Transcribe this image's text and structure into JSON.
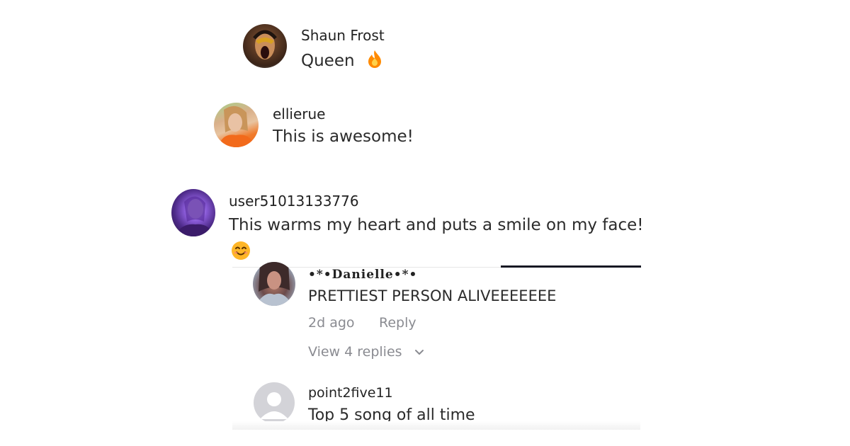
{
  "comments": [
    {
      "username": "Shaun Frost",
      "text": "Queen",
      "emoji": "fire-emoji"
    },
    {
      "username": "ellierue",
      "text": "This is awesome!"
    },
    {
      "username": "user51013133776",
      "text": "This warms my heart and puts a smile on my face!",
      "emoji": "smiling-face-emoji"
    }
  ],
  "replies": [
    {
      "username": "•*•Danielle•*•",
      "text": "PRETTIEST PERSON ALIVEEEEEEE",
      "time": "2d ago",
      "reply_label": "Reply",
      "view_replies": "View 4 replies"
    },
    {
      "username": "point2five11",
      "text": "Top 5 song of all time"
    }
  ],
  "colors": {
    "username": "#222222",
    "text": "#2b2b2b",
    "meta": "#8a8b91",
    "handle": "#161823",
    "fire": "#ff8a00"
  }
}
